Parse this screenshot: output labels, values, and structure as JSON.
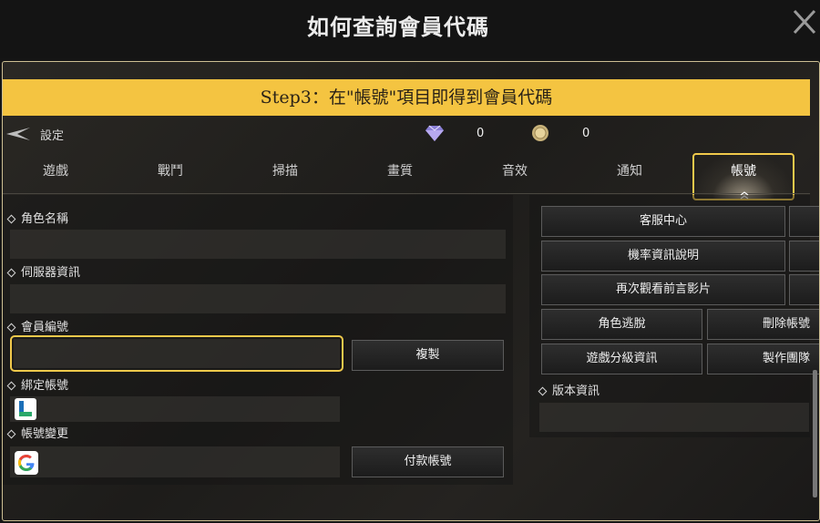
{
  "window": {
    "title": "如何查詢會員代碼"
  },
  "banner": {
    "text": "Step3：在\"帳號\"項目即得到會員代碼"
  },
  "status": {
    "settings_label": "設定",
    "diamond_count": "0",
    "coin_count": "0"
  },
  "tabs": [
    {
      "label": "遊戲"
    },
    {
      "label": "戰鬥"
    },
    {
      "label": "掃描"
    },
    {
      "label": "畫質"
    },
    {
      "label": "音效"
    },
    {
      "label": "通知"
    },
    {
      "label": "帳號",
      "active": true
    }
  ],
  "account": {
    "character_name_label": "角色名稱",
    "character_name_value": "",
    "server_info_label": "伺服器資訊",
    "server_info_value": "",
    "member_id_label": "會員編號",
    "member_id_value": "",
    "copy_button": "複製",
    "bound_account_label": "綁定帳號",
    "bound_account_value": "",
    "change_account_label": "帳號變更",
    "change_account_value": "",
    "payment_account_button": "付款帳號"
  },
  "right_menu": {
    "customer_service": "客服中心",
    "probability_info": "機率資訊說明",
    "rewatch_prologue": "再次觀看前言影片",
    "character_escape": "角色逃脫",
    "delete_account": "刪除帳號",
    "game_rating_info": "遊戲分級資訊",
    "production_team": "製作團隊",
    "version_info_label": "版本資訊",
    "version_info_value": ""
  },
  "icons": {
    "close": "close-icon",
    "back": "back-arrow-icon",
    "diamond": "diamond-icon",
    "coin": "coin-icon",
    "bind": "line-icon",
    "google": "google-icon"
  },
  "colors": {
    "highlight": "#f0c94b",
    "banner": "#f4c441",
    "frame_border": "#cdbf93"
  }
}
